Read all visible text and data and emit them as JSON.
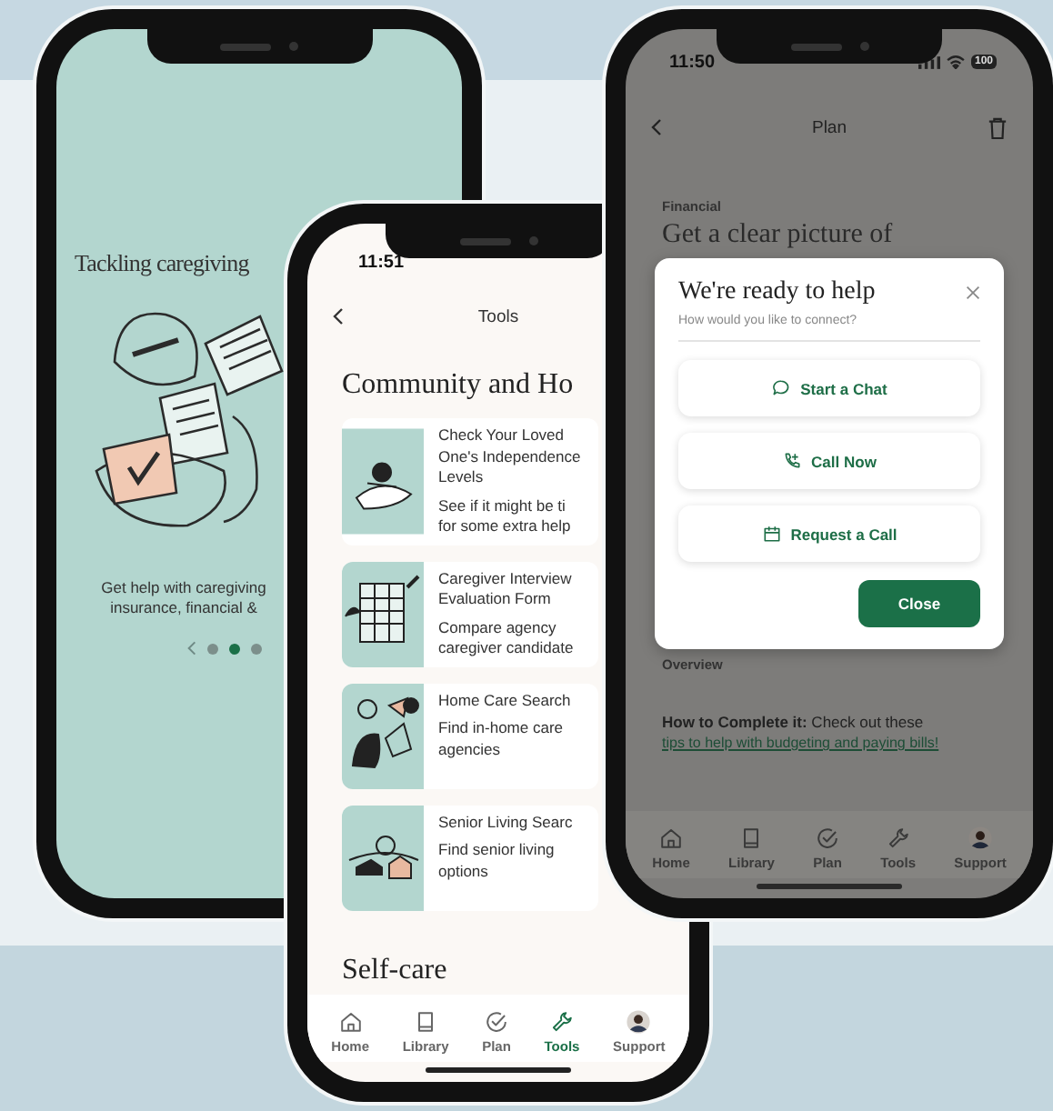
{
  "onboarding_screen": {
    "title": "Tackling caregiving",
    "caption_lines": [
      "Get help with caregiving",
      "insurance, financial &"
    ],
    "dots": [
      {
        "selected": false
      },
      {
        "selected": true
      },
      {
        "selected": false
      }
    ]
  },
  "tools_screen": {
    "status_time": "11:51",
    "header": "Tools",
    "section_title": "Community and Ho",
    "cards": [
      {
        "title_lines": [
          "Check Your Loved",
          "One's Independence",
          "Levels"
        ],
        "description_lines": [
          "See if it might be ti",
          "for some extra help"
        ]
      },
      {
        "title_lines": [
          "Caregiver Interview",
          "Evaluation Form"
        ],
        "description_lines": [
          "Compare agency",
          "caregiver candidate"
        ]
      },
      {
        "title_lines": [
          "Home Care Search"
        ],
        "description_lines": [
          "Find in-home care",
          "agencies"
        ]
      },
      {
        "title_lines": [
          "Senior Living Searc"
        ],
        "description_lines": [
          "Find senior living",
          "options"
        ]
      }
    ],
    "next_section": "Self-care",
    "nav": [
      {
        "kind": "home",
        "label": "Home",
        "selected": false
      },
      {
        "kind": "library",
        "label": "Library",
        "selected": false
      },
      {
        "kind": "plan",
        "label": "Plan",
        "selected": false
      },
      {
        "kind": "tools",
        "label": "Tools",
        "selected": true
      },
      {
        "kind": "support",
        "label": "Support",
        "selected": false
      }
    ]
  },
  "plan_screen": {
    "status_time": "11:50",
    "battery": "100",
    "header": "Plan",
    "category": "Financial",
    "heading": "Get a clear picture of",
    "modal": {
      "title": "We're ready to help",
      "subtitle": "How would you like to connect?",
      "options": [
        {
          "kind": "chat",
          "label": "Start a Chat"
        },
        {
          "kind": "call",
          "label": "Call Now"
        },
        {
          "kind": "calendar",
          "label": "Request a Call"
        }
      ],
      "close_label": "Close"
    },
    "overview_label": "Overview",
    "how_to": "**How to Complete it:** Check out these",
    "link": "tips to help with budgeting and paying bills!",
    "nav": [
      {
        "kind": "home",
        "label": "Home",
        "selected": false
      },
      {
        "kind": "library",
        "label": "Library",
        "selected": false
      },
      {
        "kind": "plan",
        "label": "Plan",
        "selected": false
      },
      {
        "kind": "tools",
        "label": "Tools",
        "selected": false
      },
      {
        "kind": "support",
        "label": "Support",
        "selected": false
      }
    ]
  }
}
